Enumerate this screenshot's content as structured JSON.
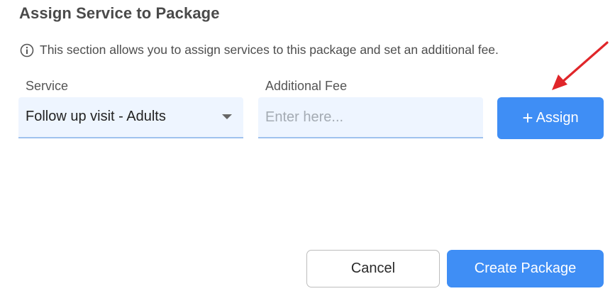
{
  "dialog": {
    "title": "Assign Service to Package",
    "info_text": "This section allows you to assign services to this package and set an additional fee."
  },
  "form": {
    "service_label": "Service",
    "service_value": "Follow up visit - Adults",
    "fee_label": "Additional Fee",
    "fee_value": "",
    "fee_placeholder": "Enter here...",
    "assign_plus": "+",
    "assign_label": "Assign"
  },
  "footer": {
    "cancel_label": "Cancel",
    "create_label": "Create Package"
  },
  "colors": {
    "primary": "#3f8ef5",
    "input_bg": "#eef5ff",
    "annotation_arrow": "#e0262a"
  },
  "icons": {
    "info": "info-circle-icon",
    "dropdown": "caret-down-icon",
    "annotation": "red-arrow-annotation"
  }
}
